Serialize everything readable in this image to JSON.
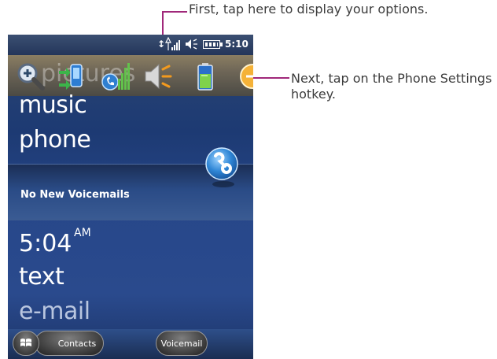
{
  "callouts": {
    "first": "First, tap here to display your options.",
    "next": "Next, tap on the Phone Settings hotkey."
  },
  "status_bar": {
    "sync_glyph": "↕",
    "time": "5:10",
    "icons": [
      "sync-icon",
      "signal-icon",
      "volume-icon",
      "battery-icon"
    ]
  },
  "hotkeys": {
    "ghost_text": "pictures",
    "items": [
      "search-hotkey",
      "sync-hotkey",
      "phone-settings-hotkey",
      "volume-hotkey",
      "battery-hotkey",
      "more-hotkey"
    ]
  },
  "home": {
    "items": {
      "music": "music",
      "phone": "phone",
      "text": "text",
      "email": "e-mail"
    },
    "voicemail_status": "No New Voicemails",
    "clock": {
      "time": "5:04",
      "ampm": "AM"
    }
  },
  "softkeys": {
    "contacts": "Contacts",
    "voicemail": "Voicemail"
  },
  "colors": {
    "callout_line": "#a0287a",
    "callout_text": "#3c3c3c",
    "phone_bg": "#1d3a73"
  }
}
